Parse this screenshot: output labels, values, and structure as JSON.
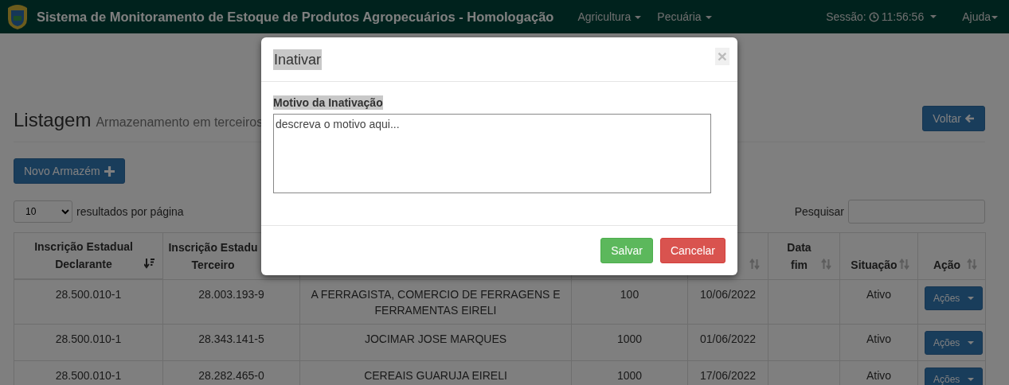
{
  "navbar": {
    "title": "Sistema de Monitoramento de Estoque de Produtos Agropecuários - Homologação",
    "menus": [
      {
        "label": "Agricultura"
      },
      {
        "label": "Pecuária"
      }
    ],
    "session": {
      "label": "Sessão:",
      "time": "11:56:56"
    },
    "help": "Ajuda"
  },
  "page": {
    "title": "Listagem",
    "subtitle": "Armazenamento em terceiros",
    "back_button": "Voltar",
    "new_button": "Novo Armazém",
    "page_size": "10",
    "page_size_label": "resultados por página",
    "search_label": "Pesquisar"
  },
  "table": {
    "columns": [
      {
        "label": "Inscrição Estadual\nDeclarante",
        "sorted": true
      },
      {
        "label": "Inscrição Estadu\nTerceiro"
      },
      {},
      {},
      {
        "sorted": false
      },
      {
        "label": "Data\nfim",
        "sorted": false
      },
      {
        "label": "Situação",
        "sorted": false
      },
      {
        "label": "Ação",
        "sorted": false
      }
    ],
    "rows": [
      {
        "cells": [
          "28.500.010-1",
          "28.003.193-9",
          "A FERRAGISTA, COMERCIO DE FERRAGENS E FERRAMENTAS EIRELI",
          "100",
          "10/06/2022",
          null,
          "Ativo"
        ],
        "action": "Ações"
      },
      {
        "cells": [
          "28.500.010-1",
          "28.343.141-5",
          "JOCIMAR JOSE MARQUES",
          "1000",
          "01/06/2022",
          null,
          "Ativo"
        ],
        "action": "Ações"
      },
      {
        "cells": [
          "28.500.010-1",
          "28.282.465-0",
          "CEREAIS GUARUJA EIRELI",
          "1000",
          "17/06/2022",
          null,
          "Ativo"
        ],
        "action": "Ações"
      }
    ]
  },
  "modal": {
    "title": "Inativar",
    "close": "×",
    "label": "Motivo da Inativação",
    "placeholder": "descreva o motivo aqui...",
    "buttons": [
      {
        "label": "Salvar",
        "kind": "success"
      },
      {
        "label": "Cancelar",
        "kind": "danger"
      }
    ]
  }
}
